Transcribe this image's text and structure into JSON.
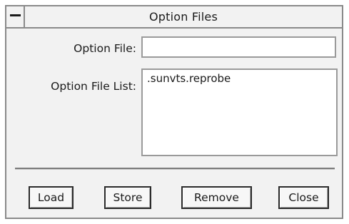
{
  "window": {
    "title": "Option Files"
  },
  "option_file": {
    "label": "Option File:",
    "value": ""
  },
  "option_file_list": {
    "label": "Option File List:",
    "items": [
      ".sunvts.reprobe"
    ]
  },
  "buttons": {
    "load": "Load",
    "store": "Store",
    "remove": "Remove",
    "close": "Close"
  },
  "icons": {
    "window_menu": "window-menu-icon"
  }
}
